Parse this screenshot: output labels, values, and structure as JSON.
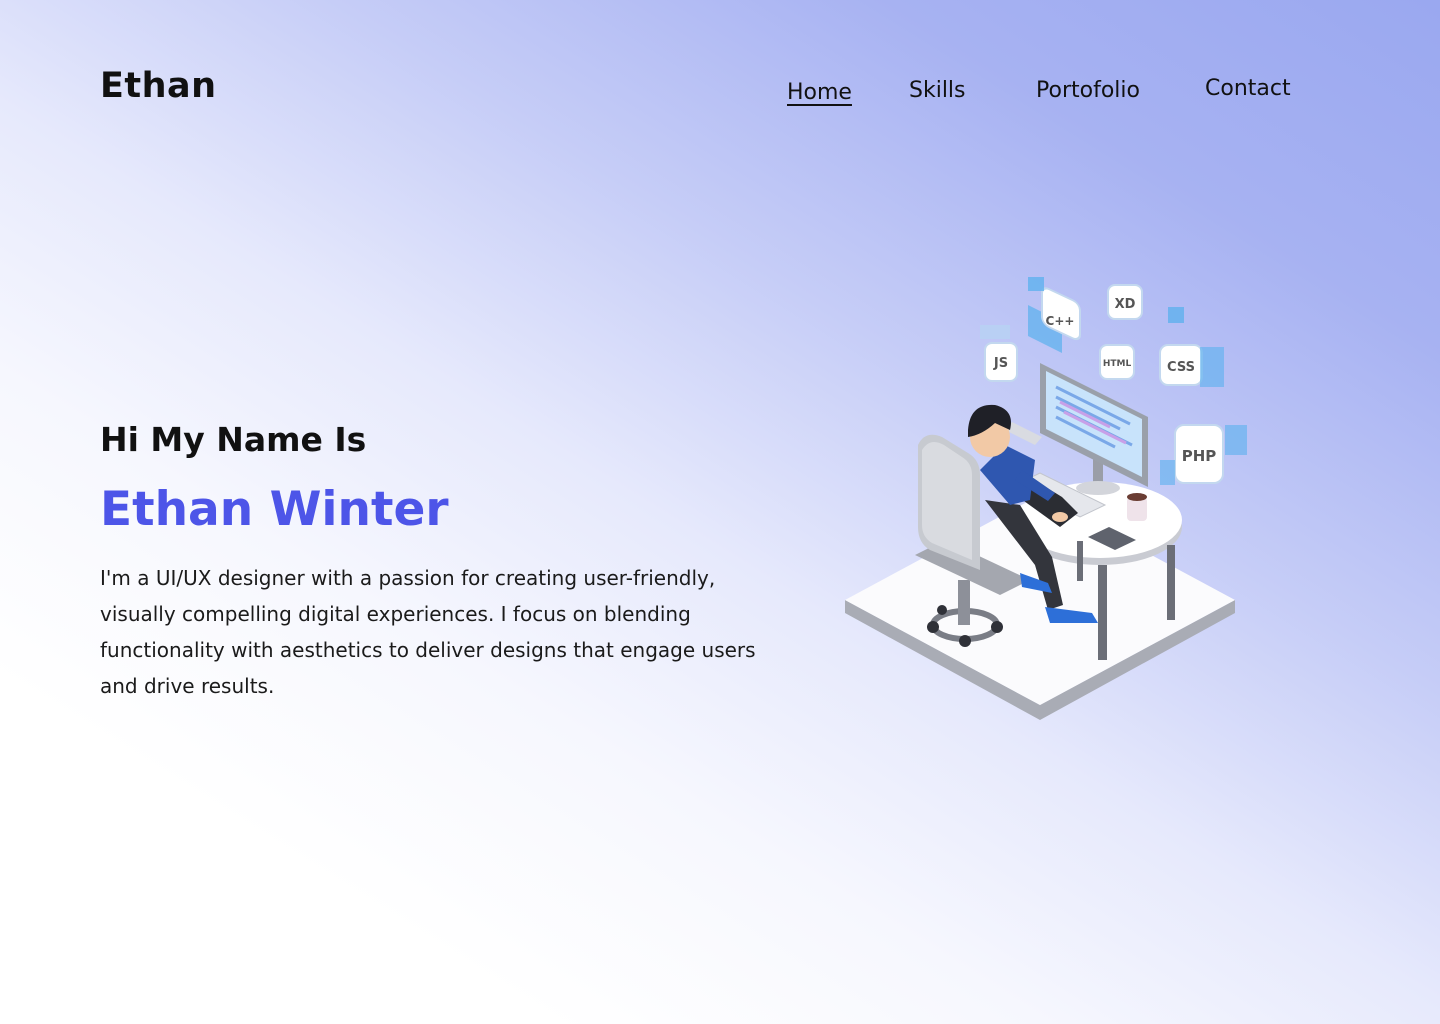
{
  "header": {
    "logo": "Ethan",
    "nav": [
      "Home",
      "Skills",
      "Portofolio",
      "Contact"
    ],
    "active_nav": "Home"
  },
  "hero": {
    "greeting": "Hi My Name Is",
    "name": "Ethan Winter",
    "bio": "I'm a UI/UX designer with a passion for creating user-friendly, visually compelling digital experiences. I focus on blending functionality with aesthetics to deliver designs that engage users and drive results."
  },
  "illustration": {
    "subject": "developer-at-desk",
    "badges": [
      "C++",
      "XD",
      "JS",
      "HTML",
      "CSS",
      "PHP"
    ]
  },
  "colors": {
    "accent": "#4d55e8",
    "background_gradient_end": "#9aa8f0",
    "text": "#111111"
  }
}
